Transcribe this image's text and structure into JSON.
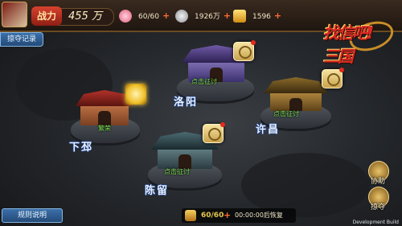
{
  "header": {
    "power_label": "战力",
    "power_value": "455 万",
    "stamina": "60/60",
    "silver": "1926万",
    "gold": "1596"
  },
  "logo_text": "找信吧!三国",
  "buttons": {
    "plunder_log": "掠夺记录",
    "rules": "规则说明",
    "assist": "协助",
    "plunder": "掠夺"
  },
  "cities": [
    {
      "name": "下邳",
      "status": "繁荣"
    },
    {
      "name": "洛阳",
      "status": "点击征讨"
    },
    {
      "name": "许昌",
      "status": "点击征讨"
    },
    {
      "name": "陈留",
      "status": "点击征讨"
    }
  ],
  "footer": {
    "count": "60/60",
    "recover_text": "00:00:00后恢复",
    "dev_build": "Development Build"
  },
  "colors": {
    "accent": "#e52a1b",
    "status_green": "#7de34e",
    "panel_blue": "#3b6fa8"
  }
}
